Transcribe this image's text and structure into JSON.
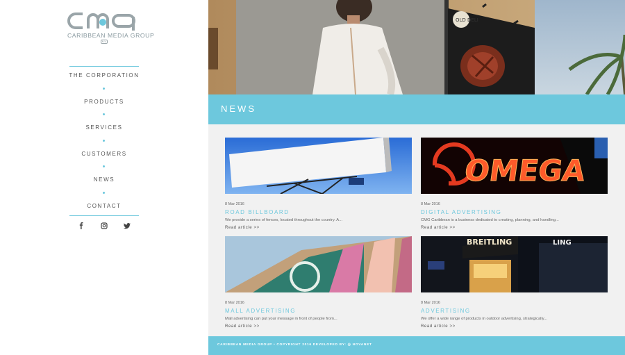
{
  "brand": {
    "logo_mark": "CMG",
    "name": "CARIBBEAN MEDIA GROUP",
    "badge": "N.V."
  },
  "nav": {
    "items": [
      {
        "label": "THE CORPORATION"
      },
      {
        "label": "PRODUCTS"
      },
      {
        "label": "SERVICES"
      },
      {
        "label": "CUSTOMERS"
      },
      {
        "label": "NEWS"
      },
      {
        "label": "CONTACT"
      }
    ]
  },
  "social": [
    "facebook-icon",
    "instagram-icon",
    "twitter-icon"
  ],
  "section": {
    "title": "NEWS"
  },
  "articles": [
    {
      "date": "8 Mar 2016",
      "title": "ROAD BILLBOARD",
      "excerpt": "We provide a series of fences, located throughout the country. A...",
      "more": "Read article >>"
    },
    {
      "date": "8 Mar 2016",
      "title": "DIGITAL ADVERTISING",
      "excerpt": "CMG Caribbean is a business dedicated to creating, planning, and handling...",
      "more": "Read article >>"
    },
    {
      "date": "8 Mar 2016",
      "title": "MALL ADVERTISING",
      "excerpt": "Mall advertising can put your message in front of people from...",
      "more": "Read article >>"
    },
    {
      "date": "8 Mar 2016",
      "title": "ADVERTISING",
      "excerpt": "We offer a wide range of products in outdoor advertising, strategically...",
      "more": "Read article >>"
    }
  ],
  "images": {
    "hero_signs": [
      "OLD DELI"
    ],
    "digital_sign": "OMEGA",
    "store_sign_1": "BREITLING",
    "store_sign_2": "LING"
  },
  "footer": {
    "text": "CARIBBEAN MEDIA GROUP • COPYRIGHT 2016 DEVELOPED BY: ◎ NOVANET"
  },
  "colors": {
    "accent": "#6dc8dd",
    "content_bg": "#f1f1f1"
  }
}
